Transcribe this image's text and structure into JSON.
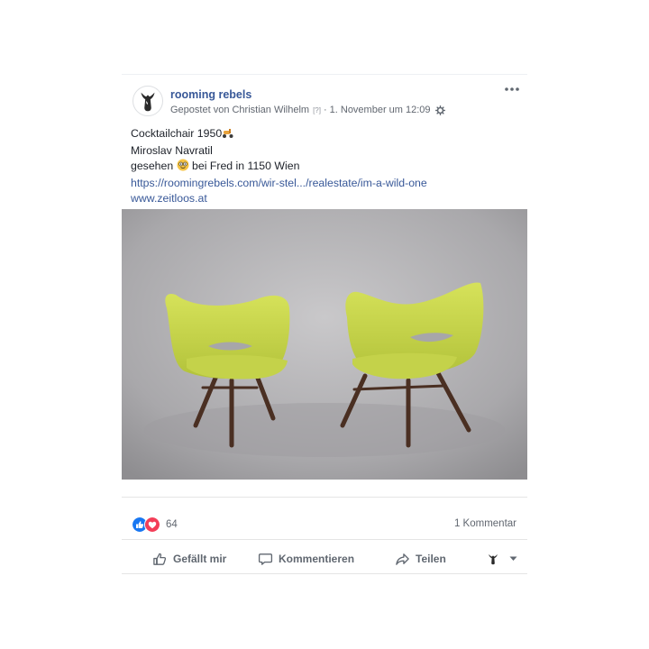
{
  "post": {
    "page_name": "rooming rebels",
    "meta": {
      "posted_by": "Gepostet von Christian Wilhelm",
      "qmark": "[?]",
      "separator": "·",
      "date": "1. November um 12:09"
    },
    "text": {
      "line1": "Cocktailchair 1950",
      "line2": "Miroslav Navratil",
      "line3_before": "gesehen",
      "line3_after": "bei Fred in 1150 Wien",
      "link1": "https://roomingrebels.com/wir-stel.../realestate/im-a-wild-one",
      "link2": "www.zeitloos.at"
    },
    "icons": {
      "avatar": "deer-antler-logo",
      "more": "more-dots-icon",
      "settings": "gear-icon",
      "emoji1": "scooter-emoji",
      "emoji2": "nerd-face-emoji"
    }
  },
  "engagement": {
    "reaction_count": "64",
    "comments": "1 Kommentar",
    "reactions": [
      "like",
      "love"
    ]
  },
  "actions": {
    "like": "Gefällt mir",
    "comment": "Kommentieren",
    "share": "Teilen"
  },
  "colors": {
    "link": "#385898",
    "text": "#1d2129",
    "meta": "#616770",
    "like_blue": "#1877f2",
    "love_red": "#f33e58",
    "chair_green": "#c6d64a"
  }
}
